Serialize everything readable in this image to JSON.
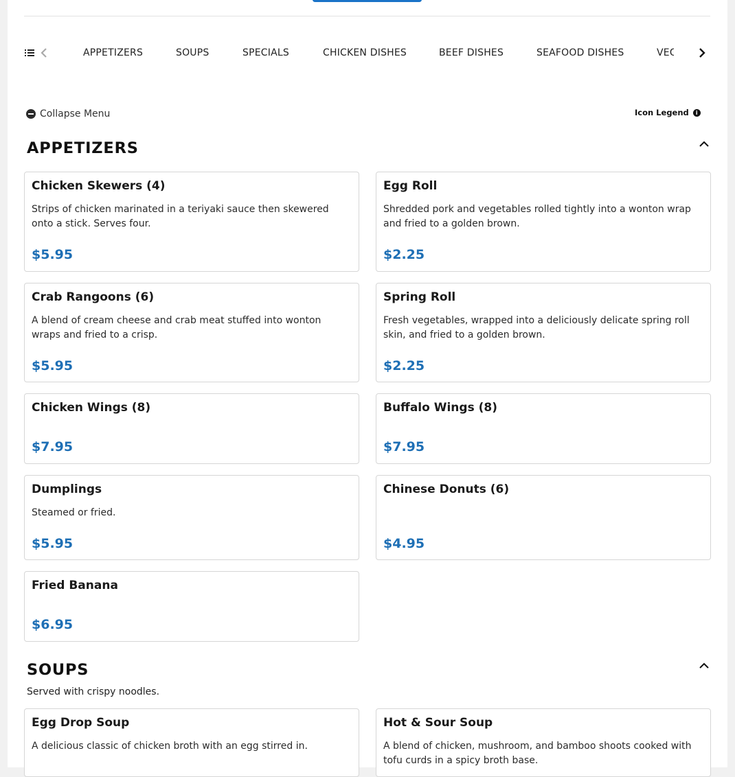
{
  "nav": {
    "tabs": [
      "APPETIZERS",
      "SOUPS",
      "SPECIALS",
      "CHICKEN DISHES",
      "BEEF DISHES",
      "SEAFOOD DISHES",
      "VEG"
    ]
  },
  "menu_controls": {
    "collapse_label": "Collapse Menu",
    "legend_label": "Icon Legend"
  },
  "sections": {
    "appetizers": {
      "title": "APPETIZERS",
      "items": [
        {
          "name": "Chicken Skewers (4)",
          "desc": "Strips of chicken marinated in a teriyaki sauce then skewered onto a stick. Serves four.",
          "price": "$5.95"
        },
        {
          "name": "Egg Roll",
          "desc": "Shredded pork and vegetables rolled tightly into a wonton wrap and fried to a golden brown.",
          "price": "$2.25"
        },
        {
          "name": "Crab Rangoons (6)",
          "desc": "A blend of cream cheese and crab meat stuffed into wonton wraps and fried to a crisp.",
          "price": "$5.95"
        },
        {
          "name": "Spring Roll",
          "desc": "Fresh vegetables, wrapped into a deliciously delicate spring roll skin, and fried to a golden brown.",
          "price": "$2.25"
        },
        {
          "name": "Chicken Wings (8)",
          "desc": "",
          "price": "$7.95"
        },
        {
          "name": "Buffalo Wings (8)",
          "desc": "",
          "price": "$7.95"
        },
        {
          "name": "Dumplings",
          "desc": "Steamed or fried.",
          "price": "$5.95"
        },
        {
          "name": "Chinese Donuts (6)",
          "desc": "",
          "price": "$4.95"
        },
        {
          "name": "Fried Banana",
          "desc": "",
          "price": "$6.95"
        }
      ]
    },
    "soups": {
      "title": "SOUPS",
      "note": "Served with crispy noodles.",
      "items": [
        {
          "name": "Egg Drop Soup",
          "desc": "A delicious classic of chicken broth with an egg stirred in."
        },
        {
          "name": "Hot & Sour Soup",
          "desc": "A blend of chicken, mushroom, and bamboo shoots cooked with tofu curds in a spicy broth base."
        }
      ]
    }
  },
  "colors": {
    "price": "#1e6fb5",
    "accent_button": "#1a73c8"
  }
}
